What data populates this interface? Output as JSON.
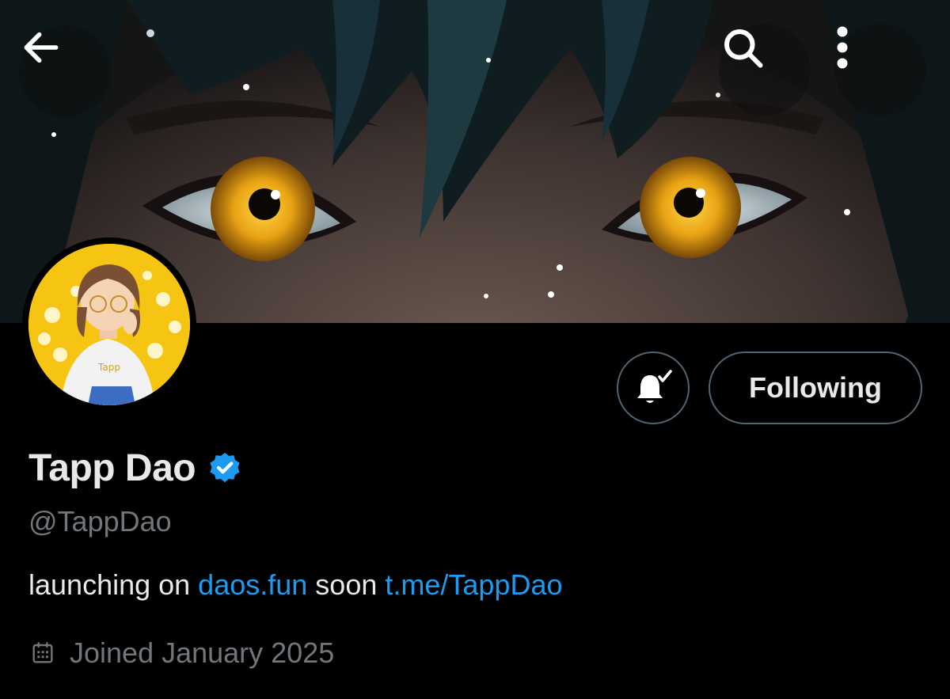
{
  "header": {
    "back_icon": "arrow-left-icon",
    "search_icon": "search-icon",
    "more_icon": "more-vertical-icon"
  },
  "profile": {
    "display_name": "Tapp Dao",
    "handle": "@TappDao",
    "verified_icon": "verified-badge-icon",
    "verified_color": "#1d9bf0",
    "bio": {
      "prefix": "launching on ",
      "link1": "daos.fun",
      "middle": " soon ",
      "link2": "t.me/TappDao"
    },
    "joined": "Joined January 2025",
    "joined_icon": "calendar-icon"
  },
  "actions": {
    "notify_icon": "bell-subscribed-icon",
    "follow_label": "Following"
  },
  "colors": {
    "background": "#000000",
    "text_primary": "#e7e9ea",
    "text_secondary": "#71767b",
    "link": "#1d9bf0",
    "button_border": "#536471",
    "eye_iris": "#e8a313"
  }
}
